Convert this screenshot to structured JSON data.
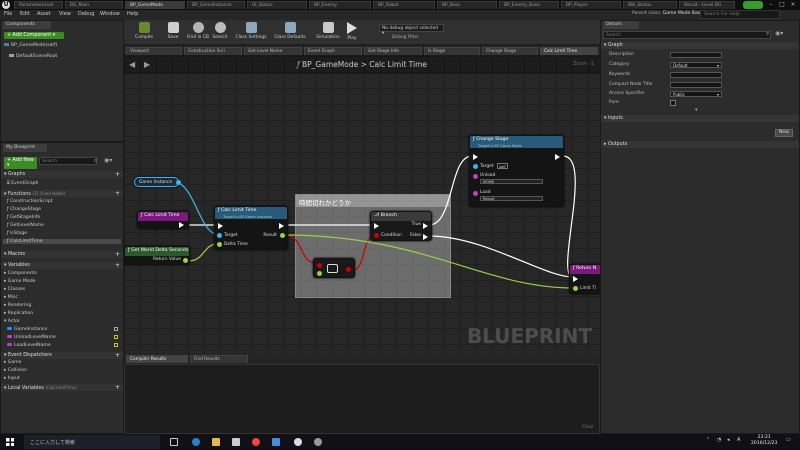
{
  "doc_tabs": [
    "ParameterLevel",
    "BG_Main",
    "BP_GameMode",
    "BP_GameInstance",
    "UI_Status",
    "BP_Enemy",
    "BP_Robot",
    "BP_Boss",
    "BP_Enemy_Base",
    "BP_Player",
    "BW_Status",
    "Result - Level BG"
  ],
  "menu": [
    "File",
    "Edit",
    "Asset",
    "View",
    "Debug",
    "Window",
    "Help"
  ],
  "parent_class_label": "Parent class:",
  "parent_class": "Game Mode Base",
  "help_placeholder": "Search For Help",
  "components": {
    "tab": "Components",
    "add": "+ Add Component ▾",
    "self": "BP_GameMode(self)",
    "root": "DefaultSceneRoot"
  },
  "my_blueprint": {
    "tab": "My Blueprint",
    "add_new": "+ Add New ▾",
    "search_ph": "Search",
    "graphs_header": "Graphs",
    "graph_items": [
      "EventGraph"
    ],
    "functions_header": "Functions",
    "functions_note": "(31 Overridable)",
    "functions": [
      "ConstructionScript",
      "ChangeStage",
      "GetStageInfo",
      "GetLevelName",
      "IsStage",
      "CalcLimitTime"
    ],
    "macros_header": "Macros",
    "variables_header": "Variables",
    "var_categories": [
      "Components",
      "Game Mode",
      "Classes",
      "Misc",
      "Rendering",
      "Replication",
      "Actor"
    ],
    "variables": [
      {
        "name": "GameInstance",
        "color": "#1e90ff"
      },
      {
        "name": "UnloadLevelName",
        "color": "#c040c0"
      },
      {
        "name": "LoadLevelName",
        "color": "#c040c0"
      }
    ],
    "dispatchers_header": "Event Dispatchers",
    "dispatcher_items": [
      "Game",
      "Collision",
      "Input"
    ],
    "locals_header": "Local Variables",
    "locals_note": "(CalcLimitTime)"
  },
  "toolbar": {
    "buttons": [
      "Compile",
      "Save",
      "Find in CB",
      "Search",
      "Class Settings",
      "Class Defaults",
      "Simulation",
      "Play"
    ],
    "debug_select": "No debug object selected ▾",
    "debug_label": "Debug Filter"
  },
  "graph_tabs": [
    "Viewport",
    "Construction Scri",
    "Get Level Name",
    "Event Graph",
    "Get Stage Info",
    "Is Stage",
    "Change Stage",
    "Calc Limit Time"
  ],
  "graph": {
    "breadcrumb": "BP_GameMode > Calc Limit Time",
    "zoom": "Zoom -1",
    "watermark": "BLUEPRINT",
    "comment": "時間切れかどうか",
    "nodes": {
      "game_instance": "Game Instance",
      "calc_func": "Calc Limit Time",
      "get_delta": "Get World Delta Seconds",
      "return_value": "Return Value",
      "calc_call": "Calc Limit Time",
      "calc_sub": "Target is BP Game Instance",
      "target": "Target",
      "delta_time": "Delta Time",
      "result": "Result",
      "branch": "Branch",
      "condition": "Condition",
      "true": "True",
      "false": "False",
      "change_stage": "Change Stage",
      "cs_sub": "Target is BP Game Mode",
      "self": "self",
      "unload": "Unload",
      "unload_val": "NONE",
      "load": "Load",
      "load_val": "Result",
      "return_node": "Return N",
      "limit_time": "Limit Ti"
    }
  },
  "bottom_tabs": [
    "Compiler Results",
    "Find Results"
  ],
  "clear": "Clear",
  "details": {
    "tab": "Details",
    "search_ph": "Search",
    "graph_header": "Graph",
    "props": [
      {
        "label": "Description",
        "value": ""
      },
      {
        "label": "Category",
        "value": "Default",
        "dropdown": true
      },
      {
        "label": "Keywords",
        "value": ""
      },
      {
        "label": "Compact Node Title",
        "value": ""
      },
      {
        "label": "Access Specifier",
        "value": "Public",
        "dropdown": true
      },
      {
        "label": "Pure",
        "value": "",
        "checkbox": true
      }
    ],
    "inputs_header": "Inputs",
    "new_btn": "New",
    "outputs_header": "Outputs"
  },
  "taskbar": {
    "search": "ここに入力して検索",
    "time": "23:21",
    "date": "2016/12/23",
    "lang": "A"
  }
}
